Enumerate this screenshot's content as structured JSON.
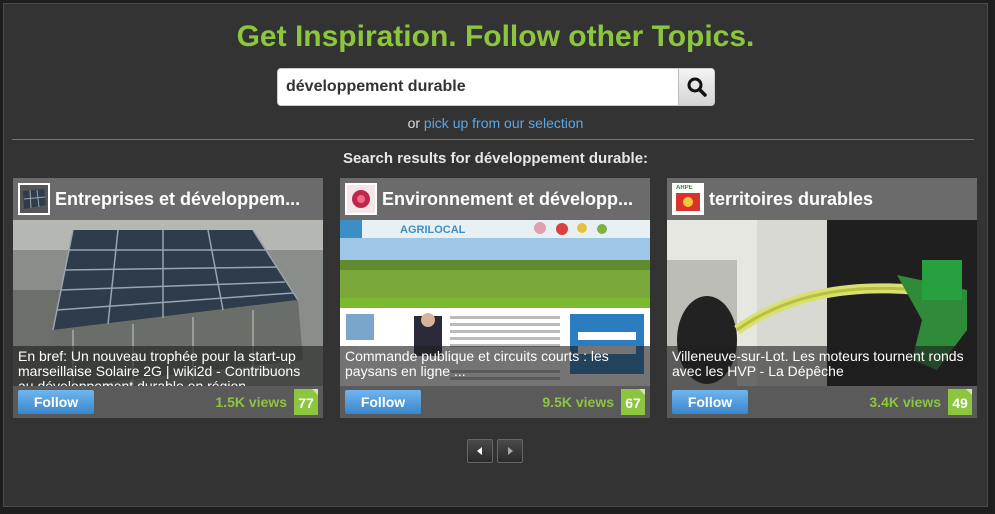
{
  "headline": "Get Inspiration. Follow other Topics.",
  "search": {
    "value": "développement durable",
    "button_icon": "search-icon"
  },
  "suggest": {
    "prefix": "or",
    "link": "pick up from our selection"
  },
  "results_title": "Search results for développement durable:",
  "cards": [
    {
      "title": "Entreprises et développem...",
      "caption": "En bref: Un nouveau trophée pour la start-up marseillaise Solaire 2G | wiki2d - Contribuons au développement durable en région",
      "follow": "Follow",
      "views": "1.5K views",
      "score": "77"
    },
    {
      "title": "Environnement et développ...",
      "caption": "Commande publique et circuits courts : les paysans en ligne ...",
      "follow": "Follow",
      "views": "9.5K views",
      "score": "67"
    },
    {
      "title": "territoires durables",
      "caption": "Villeneuve-sur-Lot. Les moteurs tournent ronds avec les HVP - La Dépêche",
      "follow": "Follow",
      "views": "3.4K views",
      "score": "49"
    }
  ],
  "website_banner": "AGRILOCAL",
  "icon_badge": "ARPE",
  "pager": {
    "prev_icon": "triangle-left-icon",
    "next_icon": "triangle-right-icon"
  },
  "colors": {
    "accent": "#8cc63f",
    "link": "#5aa7e6",
    "follow": "#4a98dc",
    "background": "#333333"
  }
}
